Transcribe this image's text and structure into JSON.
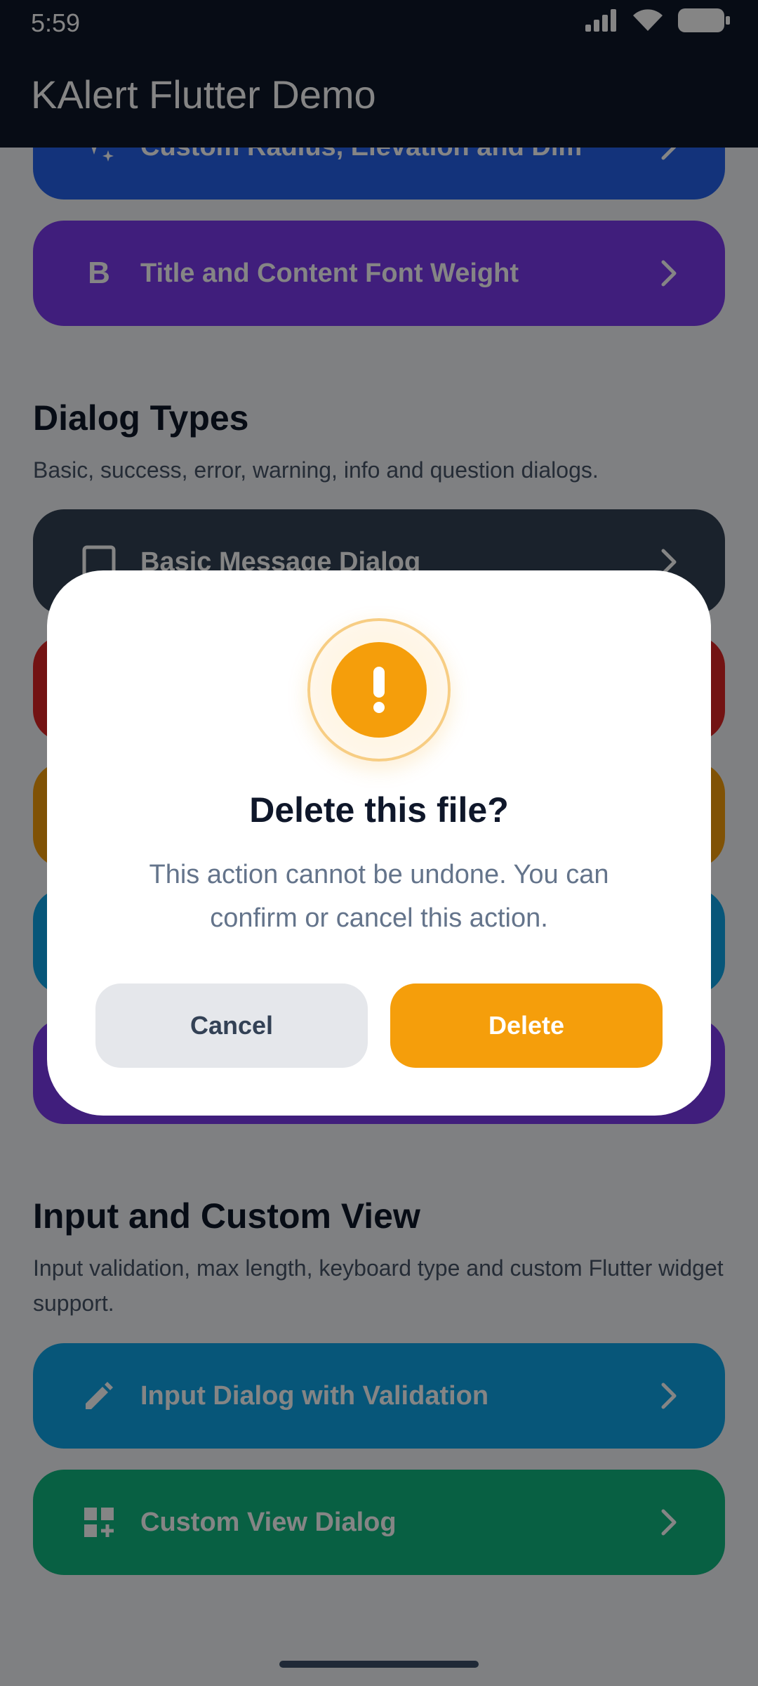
{
  "status_bar": {
    "time": "5:59"
  },
  "app_bar": {
    "title": "KAlert Flutter Demo"
  },
  "items_top": [
    {
      "label": "Custom Radius, Elevation and Dim",
      "color": "#2563eb",
      "icon": "sparkle-icon"
    },
    {
      "label": "Title and Content Font Weight",
      "color": "#7c3aed",
      "icon": "bold-b-icon",
      "icon_text": "B"
    }
  ],
  "dialog_types": {
    "title": "Dialog Types",
    "subtitle": "Basic, success, error, warning, info and question dialogs.",
    "first_item": {
      "label": "Basic Message Dialog",
      "color": "#334155",
      "icon": "message-square-icon"
    },
    "hidden_item_colors": [
      "#dc2626",
      "#f59e0b",
      "#0ea5e9",
      "#7c3aed"
    ]
  },
  "input_section": {
    "title": "Input and Custom View",
    "subtitle": "Input validation, max length, keyboard type and custom Flutter widget support.",
    "items": [
      {
        "label": "Input Dialog with Validation",
        "color": "#0ea5e9",
        "icon": "pencil-icon"
      },
      {
        "label": "Custom View Dialog",
        "color": "#10b981",
        "icon": "widgets-add-icon"
      }
    ]
  },
  "dialog": {
    "title": "Delete this file?",
    "content": "This action cannot be undone. You can confirm or cancel this action.",
    "cancel_label": "Cancel",
    "confirm_label": "Delete",
    "accent": "#f59e0b",
    "icon": "exclamation-icon"
  }
}
